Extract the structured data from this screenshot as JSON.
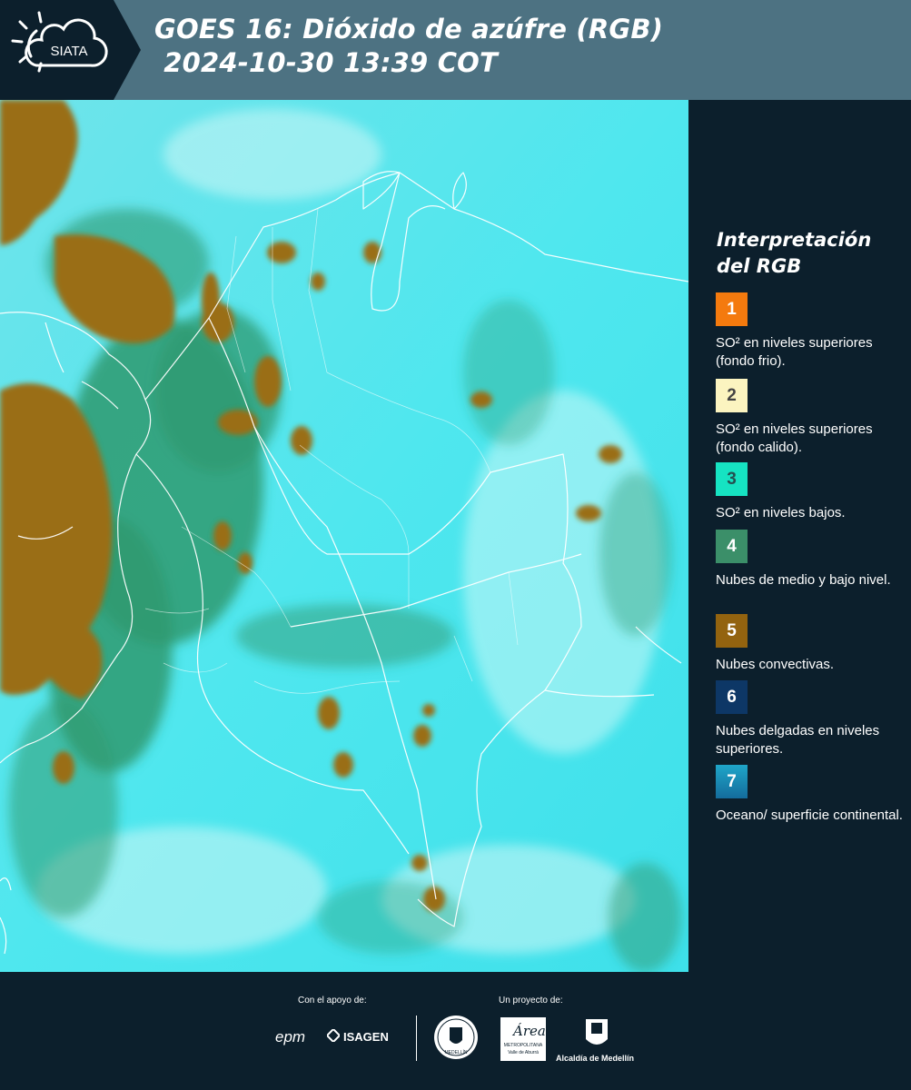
{
  "header": {
    "logo_text": "SIATA",
    "title_line1": "GOES 16: Dióxido de azúfre (RGB)",
    "title_line2": " 2024-10-30 13:39 COT"
  },
  "legend": {
    "title": "Interpretación del RGB",
    "items": [
      {
        "number": "1",
        "color": "#f47a0e",
        "text_color": "#ffffff",
        "label": "SO² en niveles superiores (fondo frio)."
      },
      {
        "number": "2",
        "color": "#fbf4c0",
        "text_color": "#444444",
        "label": "SO² en niveles superiores (fondo calido)."
      },
      {
        "number": "3",
        "color": "#16e3c2",
        "text_color": "#245050",
        "label": "SO² en niveles bajos."
      },
      {
        "number": "4",
        "color": "#3b8f69",
        "text_color": "#ffffff",
        "label": "Nubes de medio y bajo nivel."
      },
      {
        "number": "5",
        "color": "#93630f",
        "text_color": "#ffffff",
        "label": "Nubes convectivas."
      },
      {
        "number": "6",
        "color": "#0d3766",
        "text_color": "#ffffff",
        "label": "Nubes delgadas en niveles superiores."
      },
      {
        "number": "7",
        "color": "#1b8fbd",
        "text_color": "#ffffff",
        "label": "Oceano/ superficie continental."
      }
    ]
  },
  "footer": {
    "support_label": "Con el apoyo de:",
    "project_label": "Un proyecto de:",
    "sponsor_epm": "epm",
    "sponsor_isagen": "ISAGEN",
    "partner_area": "Área",
    "partner_area_sub": "METROPOLITANA",
    "partner_area_sub2": "Valle de Aburrá",
    "partner_alcaldia": "Alcaldía de Medellín",
    "seal_text": "MEDELLÍN"
  }
}
